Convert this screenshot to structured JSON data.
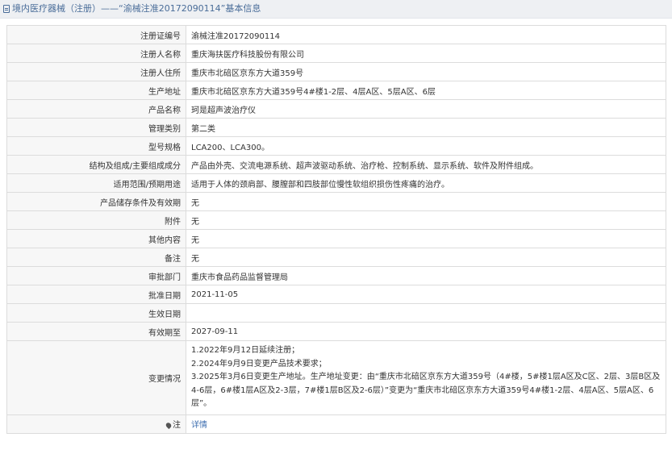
{
  "header": {
    "title": "境内医疗器械（注册）——“渝械注准20172090114”基本信息"
  },
  "fields": [
    {
      "label": "注册证编号",
      "value": "渝械注准20172090114"
    },
    {
      "label": "注册人名称",
      "value": "重庆海扶医疗科技股份有限公司"
    },
    {
      "label": "注册人住所",
      "value": "重庆市北碚区京东方大道359号"
    },
    {
      "label": "生产地址",
      "value": "重庆市北碚区京东方大道359号4#楼1-2层、4层A区、5层A区、6层"
    },
    {
      "label": "产品名称",
      "value": "珂是超声波治疗仪"
    },
    {
      "label": "管理类别",
      "value": "第二类"
    },
    {
      "label": "型号规格",
      "value": "LCA200、LCA300。"
    },
    {
      "label": "结构及组成/主要组成成分",
      "value": "产品由外壳、交流电源系统、超声波驱动系统、治疗枪、控制系统、显示系统、软件及附件组成。"
    },
    {
      "label": "适用范围/预期用途",
      "value": "适用于人体的颈肩部、腰膣部和四肢部位慢性软组织损伤性疼痛的治疗。"
    },
    {
      "label": "产品储存条件及有效期",
      "value": "无"
    },
    {
      "label": "附件",
      "value": "无"
    },
    {
      "label": "其他内容",
      "value": "无"
    },
    {
      "label": "备注",
      "value": "无"
    },
    {
      "label": "审批部门",
      "value": "重庆市食品药品监督管理局"
    },
    {
      "label": "批准日期",
      "value": "2021-11-05"
    },
    {
      "label": "生效日期",
      "value": ""
    },
    {
      "label": "有效期至",
      "value": "2027-09-11"
    }
  ],
  "changes": {
    "label": "变更情况",
    "lines": [
      "1.2022年9月12日延续注册；",
      "2.2024年9月9日变更产品技术要求；",
      "3.2025年3月6日变更生产地址。生产地址变更：由“重庆市北碚区京东方大道359号（4#楼，5#楼1层A区及C区、2层、3层B区及4-6层，6#楼1层A区及2-3层，7#楼1层B区及2-6层）”变更为“重庆市北碚区京东方大道359号4#楼1-2层、4层A区、5层A区、6层”。"
    ]
  },
  "note_row": {
    "label": "注",
    "link_text": "详情",
    "icon": "location-pin-icon"
  },
  "colors": {
    "header_text": "#4a6d99",
    "header_bg": "#eef0f3",
    "label_bg": "#f7f7f7",
    "border": "#dcdcdc",
    "link": "#3f6fb0"
  }
}
